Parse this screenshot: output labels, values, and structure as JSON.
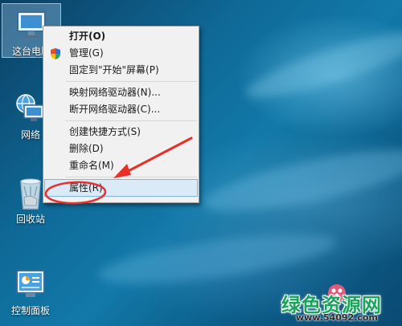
{
  "desktop": {
    "icons": [
      {
        "label": "这台电脑",
        "icon": "computer-icon"
      },
      {
        "label": "网络",
        "icon": "network-icon"
      },
      {
        "label": "回收站",
        "icon": "recycle-bin-icon"
      },
      {
        "label": "控制面板",
        "icon": "control-panel-icon"
      }
    ]
  },
  "context_menu": {
    "items": [
      {
        "label": "打开(O)",
        "bold": true
      },
      {
        "label": "管理(G)",
        "icon": "uac-shield-icon"
      },
      {
        "label": "固定到\"开始\"屏幕(P)"
      },
      {
        "label": "映射网络驱动器(N)..."
      },
      {
        "label": "断开网络驱动器(C)..."
      },
      {
        "label": "创建快捷方式(S)"
      },
      {
        "label": "删除(D)"
      },
      {
        "label": "重命名(M)"
      },
      {
        "label": "属性(R)",
        "highlighted": true
      }
    ]
  },
  "annotation": {
    "color": "#e8302a",
    "icons": [
      "red-circle-highlight",
      "red-arrow-icon"
    ]
  },
  "watermark": {
    "main": "绿色资源网",
    "url": "www.54092.com"
  },
  "colors": {
    "menu_background": "#f1f1f1",
    "menu_highlight": "#dbeaf7",
    "desktop_blue": "#0f6a98"
  }
}
